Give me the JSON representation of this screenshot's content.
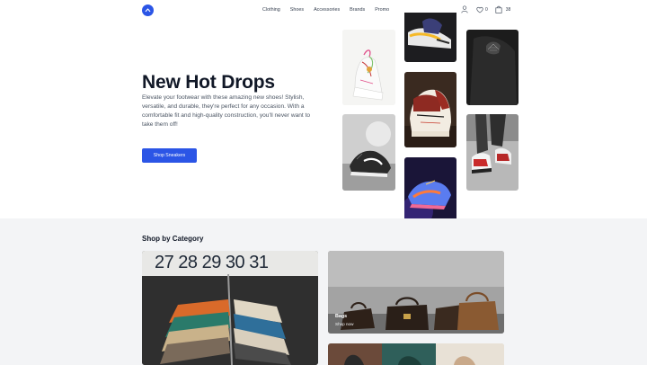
{
  "header": {
    "logo_icon": "store-logo-icon",
    "brand_color": "#2b55e6",
    "nav": [
      "Clothing",
      "Shoes",
      "Accessories",
      "Brands",
      "Promo"
    ],
    "wishlist_count": "0",
    "cart_count": "38",
    "icons": [
      "user-icon",
      "heart-icon",
      "shopping-bag-icon"
    ]
  },
  "hero": {
    "title": "New Hot Drops",
    "description": "Elevate your footwear with these amazing new shoes! Stylish, versatile, and durable, they're perfect for any occasion. With a comfortable fit and high-quality construction, you'll never want to take them off!",
    "cta_label": "Shop Sneakers"
  },
  "categories": {
    "heading": "Shop by Category",
    "rack_numbers": "27 28 29 30 31",
    "items": [
      {
        "label": "Bags",
        "link": "Shop now"
      }
    ]
  }
}
